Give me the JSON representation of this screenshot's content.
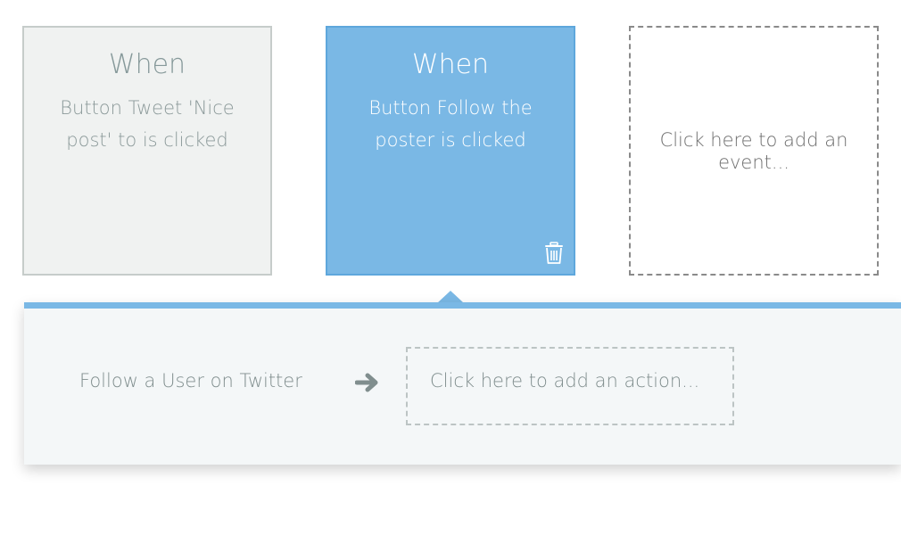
{
  "events": [
    {
      "title": "When",
      "description": "Button Tweet 'Nice post' to is clicked"
    },
    {
      "title": "When",
      "description": "Button Follow the poster is clicked"
    }
  ],
  "add_event": {
    "label": "Click here to add an event..."
  },
  "action_panel": {
    "action_label": "Follow a User on Twitter",
    "add_action_label": "Click here to add an action..."
  },
  "colors": {
    "accent": "#7ab8e5",
    "panel_bg": "#f4f7f8",
    "inactive_card_bg": "#f0f2f1"
  },
  "icons": {
    "delete": "trash-icon",
    "connector": "arrow-right-icon"
  }
}
